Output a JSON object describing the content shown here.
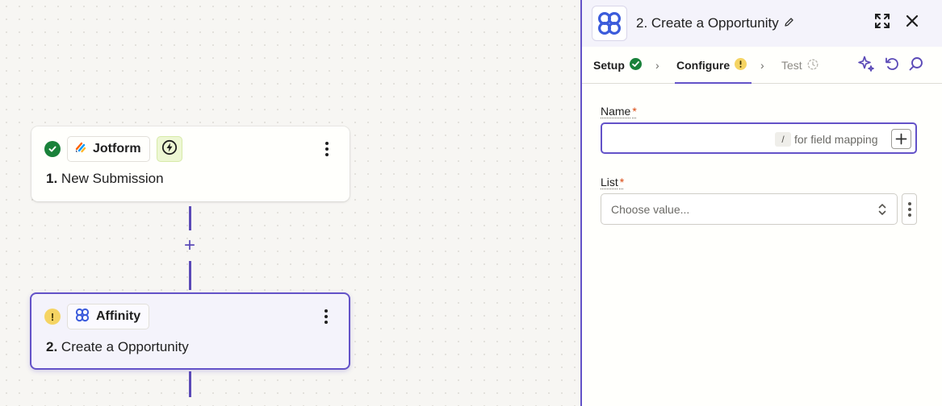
{
  "canvas": {
    "trigger": {
      "app_name": "Jotform",
      "step_number": "1.",
      "step_title": "New Submission",
      "status": "complete",
      "icon": "jotform-logo-icon"
    },
    "action": {
      "app_name": "Affinity",
      "step_number": "2.",
      "step_title": "Create a Opportunity",
      "status": "warning",
      "icon": "affinity-logo-icon"
    },
    "add_step_symbol": "+"
  },
  "panel": {
    "title": "2. Create a Opportunity",
    "tabs": [
      {
        "label": "Setup",
        "status": "complete"
      },
      {
        "label": "Configure",
        "status": "warning",
        "active": true
      },
      {
        "label": "Test",
        "status": "pending"
      }
    ],
    "fields": {
      "name": {
        "label": "Name",
        "required_mark": "*",
        "value": "",
        "slash_key": "/",
        "hint": "for field mapping"
      },
      "list": {
        "label": "List",
        "required_mark": "*",
        "placeholder": "Choose value..."
      }
    }
  },
  "colors": {
    "accent": "#6352c8",
    "success": "#19813a",
    "warning": "#f5d463",
    "required": "#d9480f"
  }
}
